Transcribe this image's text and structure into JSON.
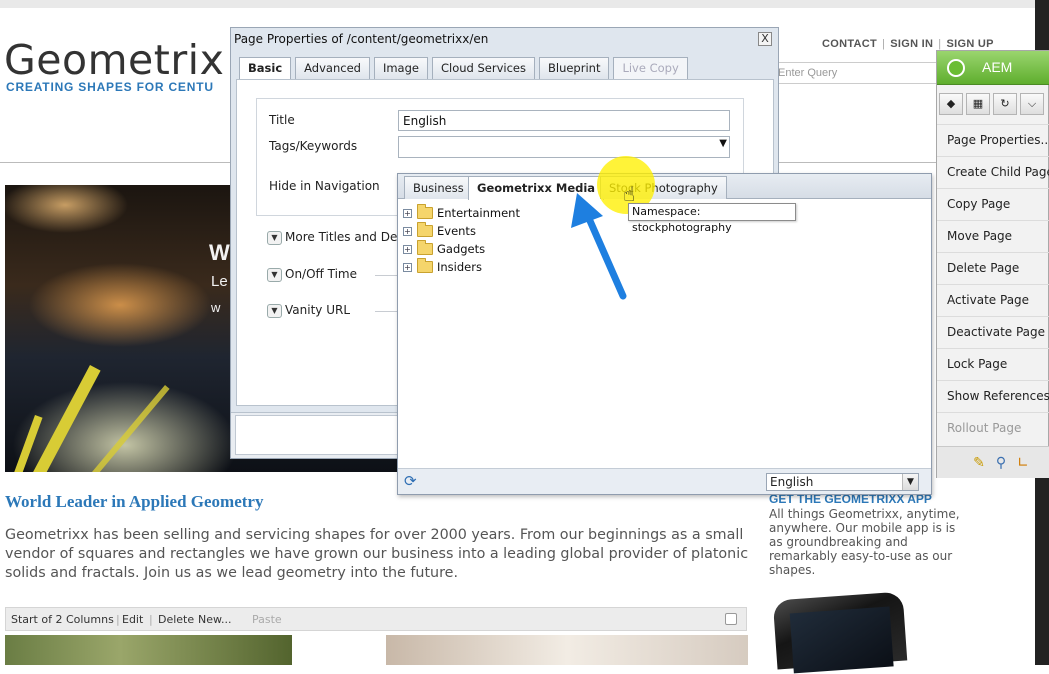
{
  "site": {
    "logo": "Geometrix",
    "tagline": "CREATING SHAPES FOR CENTU",
    "toplinks": [
      "CONTACT",
      "SIGN IN",
      "SIGN UP"
    ],
    "search_placeholder": "Enter Query",
    "hero_letter": "W",
    "hero_line2": "Le",
    "hero_line3": "w",
    "heading": "World Leader in Applied Geometry",
    "paragraph": "Geometrixx has been selling and servicing shapes for over 2000 years. From our beginnings as a small vendor of squares and rectangles we have grown our business into a leading global provider of platonic solids and fractals. Join us as we lead geometry into the future.",
    "app_title": "GET THE GEOMETRIXX APP",
    "app_text": "All things Geometrixx, anytime, anywhere. Our mobile app is is as groundbreaking and remarkably easy-to-use as our shapes.",
    "columns_bar": {
      "start": "Start of 2 Columns",
      "edit": "Edit",
      "delete": "Delete",
      "new": "New...",
      "paste": "Paste"
    }
  },
  "dialog": {
    "title": "Page Properties of /content/geometrixx/en",
    "close": "X",
    "tabs": [
      {
        "label": "Basic",
        "state": "active"
      },
      {
        "label": "Advanced",
        "state": "normal"
      },
      {
        "label": "Image",
        "state": "normal"
      },
      {
        "label": "Cloud Services",
        "state": "normal"
      },
      {
        "label": "Blueprint",
        "state": "normal"
      },
      {
        "label": "Live Copy",
        "state": "disabled"
      }
    ],
    "title_label": "Title",
    "title_value": "English",
    "tags_label": "Tags/Keywords",
    "hide_label": "Hide in Navigation",
    "sections": [
      "More Titles and Descr",
      "On/Off Time",
      "Vanity URL"
    ]
  },
  "tag_picker": {
    "tabs": [
      "Business",
      "Geometrixx Media",
      "Stock Photography"
    ],
    "active_tab": "Geometrixx Media",
    "tree": [
      "Entertainment",
      "Events",
      "Gadgets",
      "Insiders"
    ],
    "tooltip": "Namespace: stockphotography",
    "language": "English"
  },
  "sidekick": {
    "title": "AEM",
    "menu": [
      {
        "label": "Page Properties...",
        "enabled": true
      },
      {
        "label": "Create Child Page",
        "enabled": true
      },
      {
        "label": "Copy Page",
        "enabled": true
      },
      {
        "label": "Move Page",
        "enabled": true
      },
      {
        "label": "Delete Page",
        "enabled": true
      },
      {
        "label": "Activate Page",
        "enabled": true
      },
      {
        "label": "Deactivate Page",
        "enabled": true
      },
      {
        "label": "Lock Page",
        "enabled": true
      },
      {
        "label": "Show References...",
        "enabled": true
      },
      {
        "label": "Rollout Page",
        "enabled": false
      }
    ]
  },
  "colors": {
    "brand_blue": "#2c78b8",
    "aem_green": "#5fae2e",
    "highlight_yellow": "#fff000",
    "arrow_blue": "#1e7fe0"
  }
}
